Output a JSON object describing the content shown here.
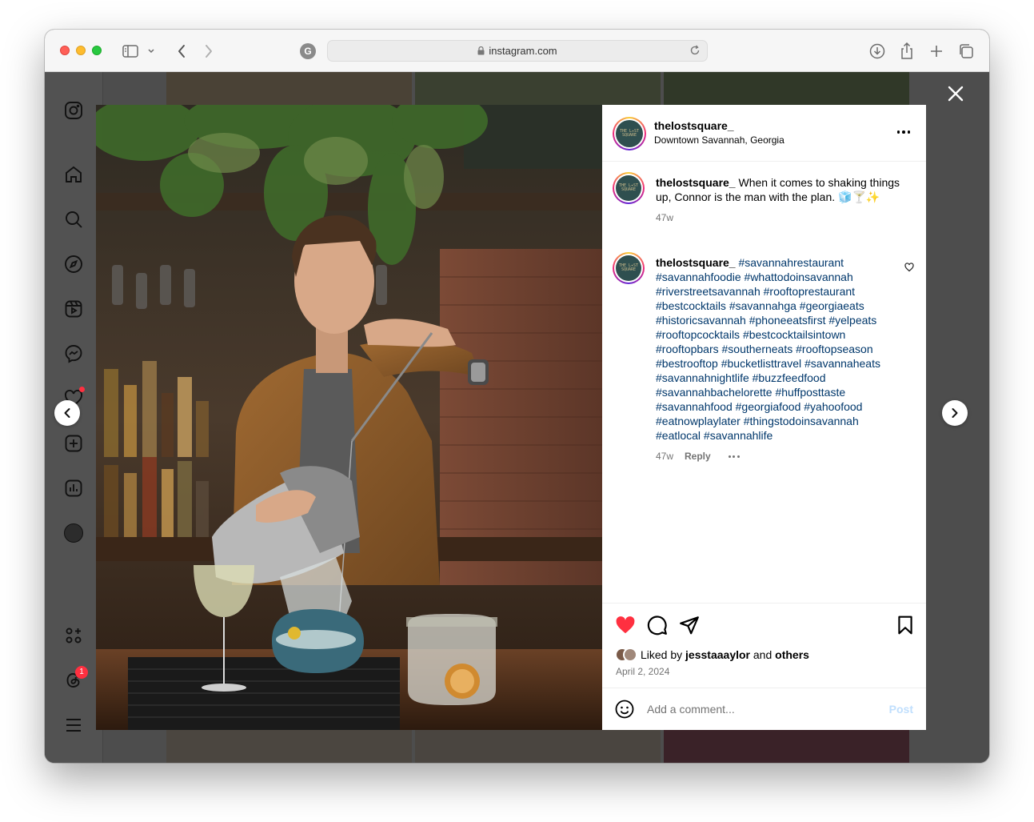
{
  "browser": {
    "url": "instagram.com",
    "favicon_letter": "G"
  },
  "post": {
    "username": "thelostsquare_",
    "location": "Downtown Savannah, Georgia",
    "avatar_text": "THE L✦ST SQUARE",
    "caption_username": "thelostsquare_",
    "caption_text": "When it comes to shaking things up, Connor is the man with the plan. 🧊🍸✨",
    "caption_age": "47w",
    "comment": {
      "username": "thelostsquare_",
      "hashtags": "#savannahrestaurant #savannahfoodie #whattodoinsavannah #riverstreetsavannah #rooftoprestaurant #bestcocktails #savannahga #georgiaeats #historicsavannah #phoneeatsfirst #yelpeats #rooftopcocktails #bestcocktailsintown #rooftopbars #southerneats #rooftopseason #bestrooftop #bucketlisttravel #savannaheats #savannahnightlife #buzzfeedfood #savannahbachelorette #huffposttaste #savannahfood #georgiafood #yahoofood #eatnowplaylater #thingstodoinsavannah #eatlocal #savannahlife",
      "age": "47w",
      "reply_label": "Reply"
    },
    "liked_prefix": "Liked by",
    "liked_user": "jesstaaaylor",
    "liked_and": "and",
    "liked_others": "others",
    "date": "April 2, 2024",
    "comment_placeholder": "Add a comment...",
    "post_label": "Post"
  },
  "sidebar": {
    "notification_badge": "1"
  },
  "colors": {
    "like_red": "#ff3040",
    "hashtag_blue": "#00376b",
    "post_disabled": "#c0dffd"
  }
}
